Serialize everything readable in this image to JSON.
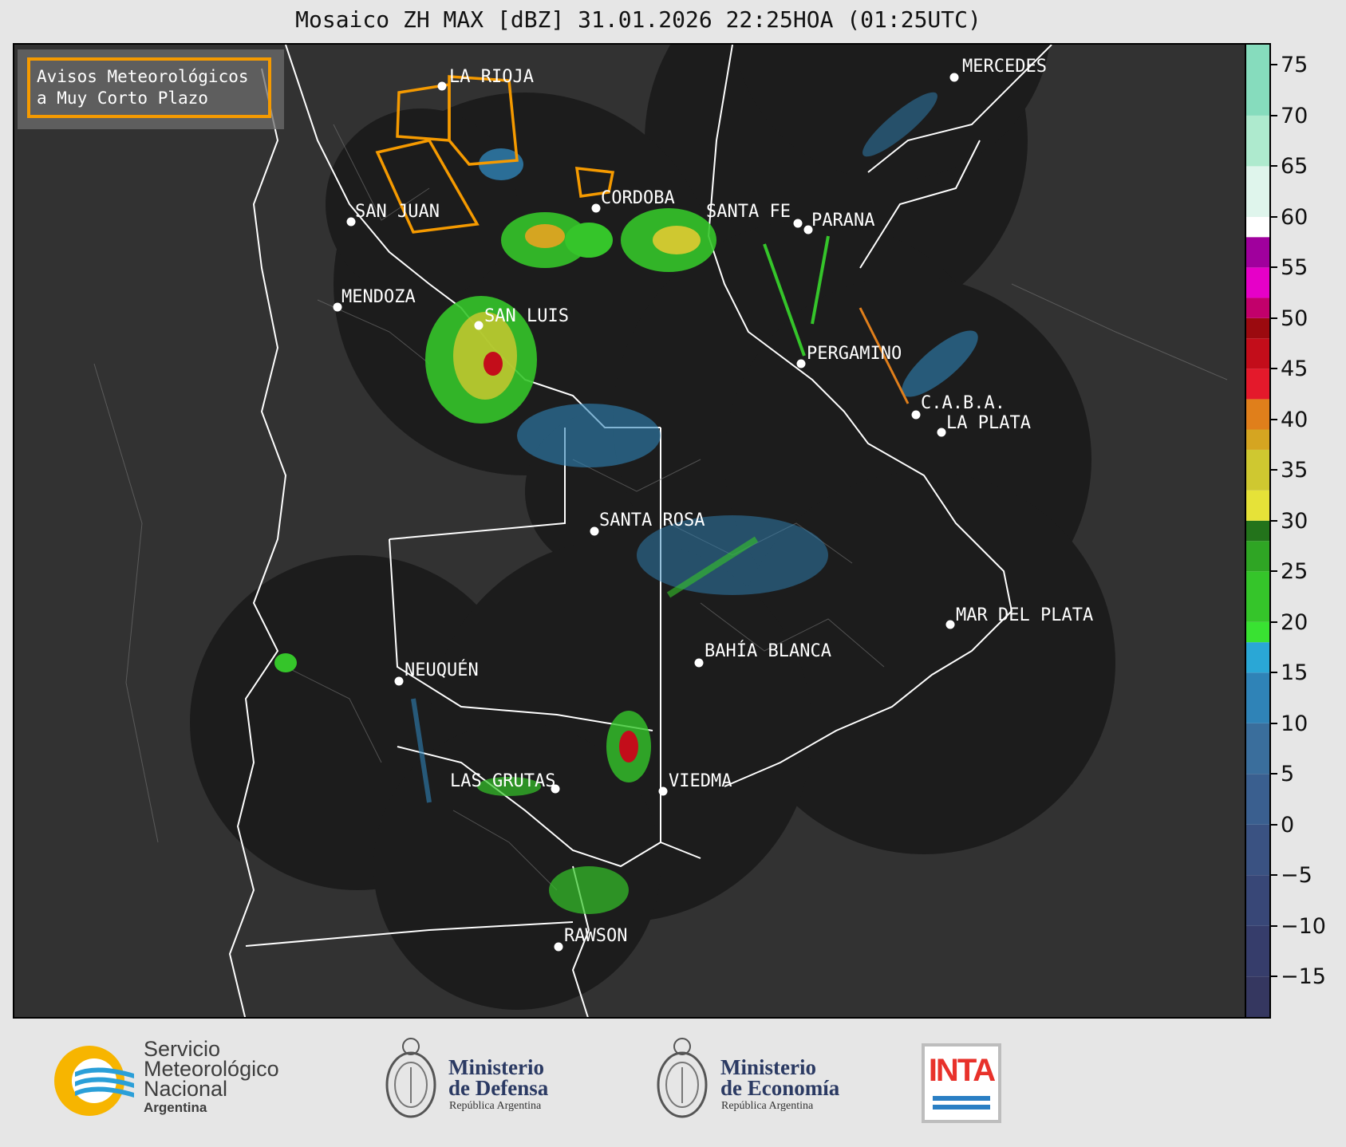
{
  "title": "Mosaico ZH MAX [dBZ] 31.01.2026 22:25HOA (01:25UTC)",
  "warning_box": {
    "text": "Avisos Meteorológicos\na Muy Corto Plazo",
    "border_color": "#f59a00"
  },
  "cities": [
    {
      "name": "LA RIOJA",
      "label": "LA RIOJA"
    },
    {
      "name": "SAN JUAN",
      "label": "SAN JUAN"
    },
    {
      "name": "CORDOBA",
      "label": "CORDOBA"
    },
    {
      "name": "SANTA FE",
      "label": "SANTA FE"
    },
    {
      "name": "PARANA",
      "label": "PARANA"
    },
    {
      "name": "MENDOZA",
      "label": "MENDOZA"
    },
    {
      "name": "SAN LUIS",
      "label": "SAN LUIS"
    },
    {
      "name": "PERGAMINO",
      "label": "PERGAMINO"
    },
    {
      "name": "C.A.B.A.",
      "label": "C.A.B.A."
    },
    {
      "name": "LA PLATA",
      "label": "LA PLATA"
    },
    {
      "name": "MERCEDES",
      "label": "MERCEDES"
    },
    {
      "name": "SANTA ROSA",
      "label": "SANTA ROSA"
    },
    {
      "name": "MAR DEL PLATA",
      "label": "MAR DEL PLATA"
    },
    {
      "name": "BAHIA BLANCA",
      "label": "BAHÍA BLANCA"
    },
    {
      "name": "NEUQUEN",
      "label": "NEUQUÉN"
    },
    {
      "name": "LAS GRUTAS",
      "label": "LAS GRUTAS"
    },
    {
      "name": "VIEDMA",
      "label": "VIEDMA"
    },
    {
      "name": "RAWSON",
      "label": "RAWSON"
    }
  ],
  "colorbar": {
    "unit": "dBZ",
    "range": [
      -19,
      77
    ],
    "ticks": [
      "75",
      "70",
      "65",
      "60",
      "55",
      "50",
      "45",
      "40",
      "35",
      "30",
      "25",
      "20",
      "15",
      "10",
      "5",
      "0",
      "−5",
      "−10",
      "−15"
    ],
    "tick_values": [
      75,
      70,
      65,
      60,
      55,
      50,
      45,
      40,
      35,
      30,
      25,
      20,
      15,
      10,
      5,
      0,
      -5,
      -10,
      -15
    ],
    "bands": [
      {
        "from": -19,
        "to": -15,
        "color": "#353760"
      },
      {
        "from": -15,
        "to": -10,
        "color": "#363d6b"
      },
      {
        "from": -10,
        "to": -5,
        "color": "#384777"
      },
      {
        "from": -5,
        "to": 0,
        "color": "#3a5282"
      },
      {
        "from": 0,
        "to": 5,
        "color": "#3a5f8f"
      },
      {
        "from": 5,
        "to": 10,
        "color": "#3a6e9c"
      },
      {
        "from": 10,
        "to": 15,
        "color": "#2f83b7"
      },
      {
        "from": 15,
        "to": 18,
        "color": "#2aa7d6"
      },
      {
        "from": 18,
        "to": 20,
        "color": "#39e232"
      },
      {
        "from": 20,
        "to": 25,
        "color": "#35c52a"
      },
      {
        "from": 25,
        "to": 28,
        "color": "#2fa524"
      },
      {
        "from": 28,
        "to": 30,
        "color": "#23731b"
      },
      {
        "from": 30,
        "to": 33,
        "color": "#e6e238"
      },
      {
        "from": 33,
        "to": 37,
        "color": "#cfc830"
      },
      {
        "from": 37,
        "to": 39,
        "color": "#d5a521"
      },
      {
        "from": 39,
        "to": 42,
        "color": "#e07f1b"
      },
      {
        "from": 42,
        "to": 45,
        "color": "#e4192b"
      },
      {
        "from": 45,
        "to": 48,
        "color": "#c30d1a"
      },
      {
        "from": 48,
        "to": 50,
        "color": "#9b0a0f"
      },
      {
        "from": 50,
        "to": 52,
        "color": "#c2006b"
      },
      {
        "from": 52,
        "to": 55,
        "color": "#e600c8"
      },
      {
        "from": 55,
        "to": 58,
        "color": "#a0009d"
      },
      {
        "from": 58,
        "to": 60,
        "color": "#ffffff"
      },
      {
        "from": 60,
        "to": 65,
        "color": "#dff5ec"
      },
      {
        "from": 65,
        "to": 70,
        "color": "#aeeace"
      },
      {
        "from": 70,
        "to": 77,
        "color": "#86dcbd"
      }
    ]
  },
  "footer": {
    "smn": {
      "line1": "Servicio",
      "line2": "Meteorológico",
      "line3": "Nacional",
      "line4": "Argentina"
    },
    "defensa": {
      "line1": "Ministerio",
      "line2": "de Defensa",
      "line3": "República Argentina"
    },
    "economia": {
      "line1": "Ministerio",
      "line2": "de Economía",
      "line3": "República Argentina"
    },
    "inta": {
      "label": "INTA"
    }
  },
  "colors": {
    "background": "#323232",
    "radar_coverage": "#1c1c1c",
    "boundary": "#ffffff",
    "warning_polygon": "#f59a00"
  }
}
